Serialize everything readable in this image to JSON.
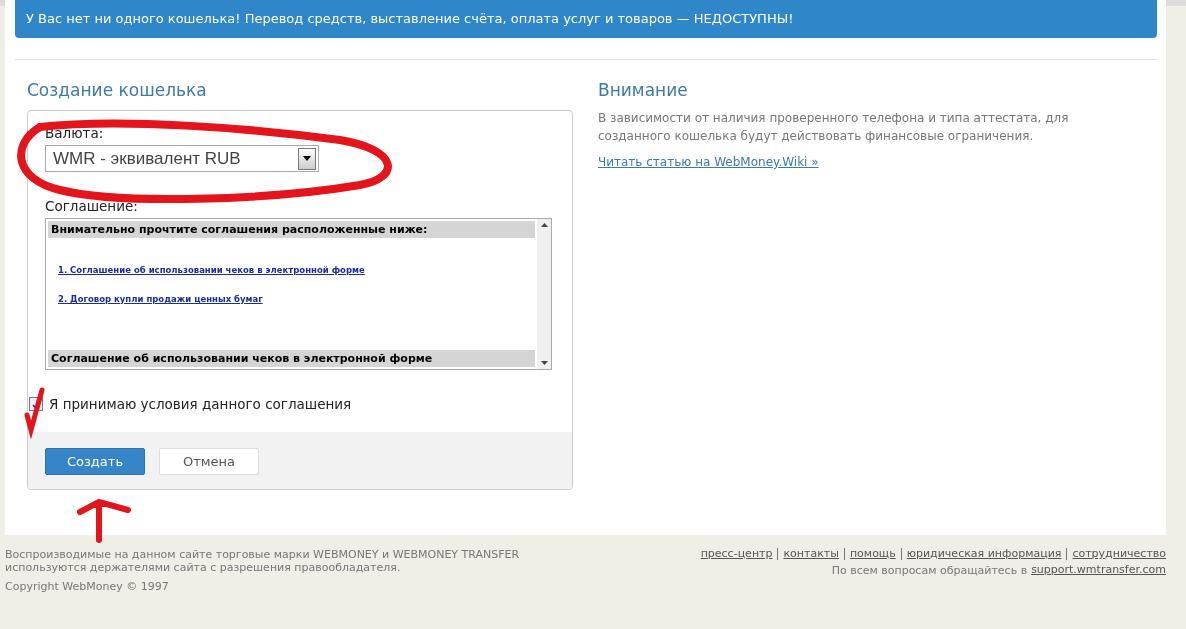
{
  "banner": {
    "text": "У Вас нет ни одного кошелька! Перевод средств, выставление счёта, оплата услуг и товаров — НЕДОСТУПНЫ!"
  },
  "create_wallet": {
    "title": "Создание кошелька",
    "currency_label": "Валюта:",
    "currency_value": "WMR - эквивалент RUB",
    "agreement_label": "Соглашение:",
    "agreement_box": {
      "header": "Внимательно прочтите соглашения расположенные ниже:",
      "links": [
        "1. Соглашение об использовании чеков в электронной форме",
        "2. Договор купли продажи ценных бумаг"
      ],
      "section_heading": "Соглашение об использовании чеков в электронной форме"
    },
    "accept": {
      "label": "Я принимаю условия данного соглашения",
      "checked": true
    },
    "buttons": [
      {
        "label": "Создать",
        "kind": "primary"
      },
      {
        "label": "Отмена",
        "kind": "secondary"
      }
    ]
  },
  "notice": {
    "title": "Внимание",
    "text": "В зависимости от наличия проверенного телефона и типа аттестата, для созданного кошелька будут действовать финансовые ограничения.",
    "link": "Читать статью на WebMoney.Wiki »"
  },
  "footer": {
    "trademark": "Воспроизводимые на данном сайте торговые марки WEBMONEY и WEBMONEY TRANSFER используются держателями сайта с разрешения правообладателя.",
    "copyright": "Copyright WebMoney © 1997",
    "links": [
      "пресс-центр",
      "контакты",
      "помощь",
      "юридическая информация",
      "сотрудничество"
    ],
    "support_text": "По всем вопросам обращайтесь в",
    "support_link": "support.wmtransfer.com"
  }
}
